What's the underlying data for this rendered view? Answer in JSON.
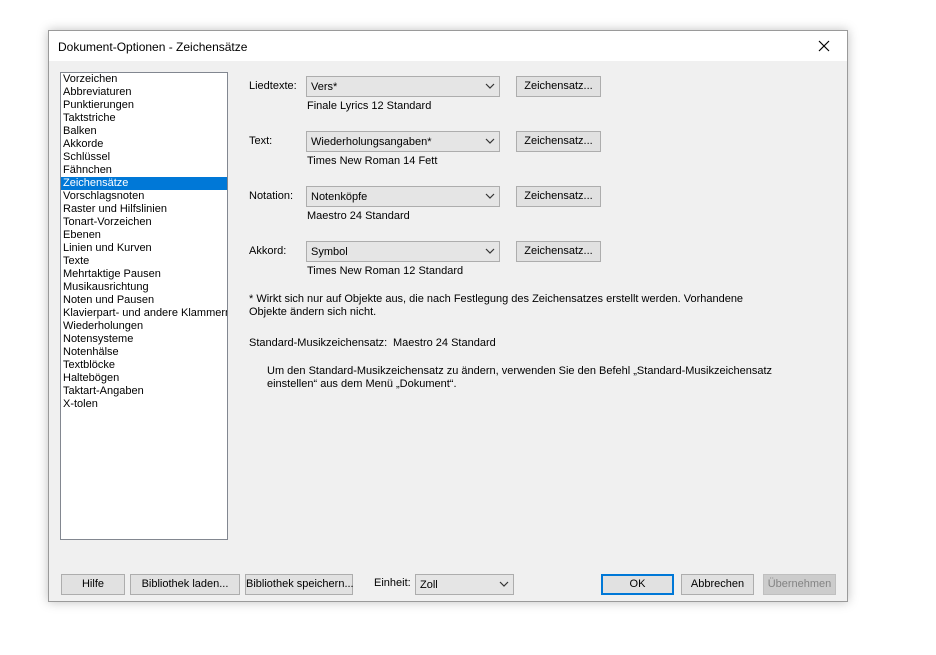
{
  "window": {
    "title": "Dokument-Optionen - Zeichensätze"
  },
  "sidebar": {
    "items": [
      "Vorzeichen",
      "Abbreviaturen",
      "Punktierungen",
      "Taktstriche",
      "Balken",
      "Akkorde",
      "Schlüssel",
      "Fähnchen",
      "Zeichensätze",
      "Vorschlagsnoten",
      "Raster und Hilfslinien",
      "Tonart-Vorzeichen",
      "Ebenen",
      "Linien und Kurven",
      "Texte",
      "Mehrtaktige Pausen",
      "Musikausrichtung",
      "Noten und Pausen",
      "Klavierpart- und andere Klammern",
      "Wiederholungen",
      "Notensysteme",
      "Notenhälse",
      "Textblöcke",
      "Haltebögen",
      "Taktart-Angaben",
      "X-tolen"
    ],
    "selected": "Zeichensätze"
  },
  "fonts": [
    {
      "label": "Liedtexte:",
      "value": "Vers*",
      "description": "Finale Lyrics 12 Standard",
      "button": "Zeichensatz..."
    },
    {
      "label": "Text:",
      "value": "Wiederholungsangaben*",
      "description": "Times New Roman 14 Fett",
      "button": "Zeichensatz..."
    },
    {
      "label": "Notation:",
      "value": "Notenköpfe",
      "description": "Maestro 24 Standard",
      "button": "Zeichensatz..."
    },
    {
      "label": "Akkord:",
      "value": "Symbol",
      "description": "Times New Roman 12 Standard",
      "button": "Zeichensatz..."
    }
  ],
  "note": {
    "line1": "* Wirkt sich nur auf Objekte aus, die nach Festlegung des Zeichensatzes erstellt werden. Vorhandene",
    "line2": "Objekte ändern sich nicht."
  },
  "standard_font": {
    "label": "Standard-Musikzeichensatz:",
    "value": "Maestro 24 Standard"
  },
  "hint": {
    "line1": "Um den Standard-Musikzeichensatz zu ändern, verwenden Sie den Befehl „Standard-Musikzeichensatz",
    "line2": "einstellen“ aus dem Menü „Dokument“."
  },
  "footer": {
    "help": "Hilfe",
    "load_library": "Bibliothek laden...",
    "save_library": "Bibliothek speichern...",
    "unit_label": "Einheit:",
    "unit_value": "Zoll",
    "ok": "OK",
    "cancel": "Abbrechen",
    "apply": "Übernehmen"
  },
  "colors": {
    "selection": "#0078d7",
    "default_button_border": "#0078d7"
  }
}
